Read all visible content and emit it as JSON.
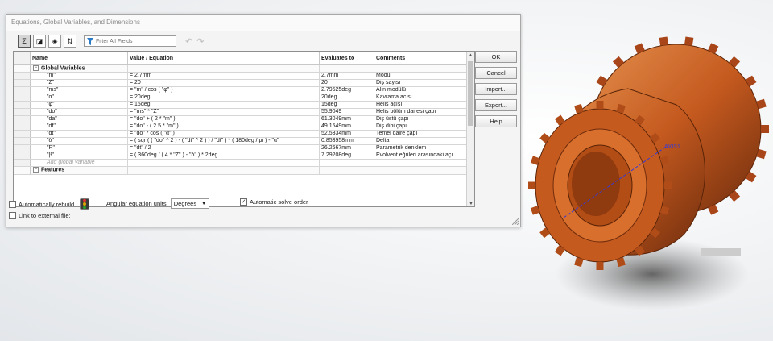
{
  "dialog": {
    "title": "Equations, Global Variables, and Dimensions",
    "filter_placeholder": "Filter All Fields"
  },
  "toolbar": {
    "icons": [
      "equation-view-icon",
      "sketch-view-icon",
      "dimension-view-icon",
      "ordered-view-icon",
      "filter-icon",
      "undo-icon",
      "redo-icon"
    ]
  },
  "table": {
    "headers": {
      "name": "Name",
      "equation": "Value / Equation",
      "evaluates": "Evaluates to",
      "comments": "Comments"
    },
    "section_global": "Global Variables",
    "rows": [
      {
        "name": "\"m\"",
        "equation": "= 2.7mm",
        "evaluates": "2.7mm",
        "comment": "Modül"
      },
      {
        "name": "\"Z\"",
        "equation": "= 20",
        "evaluates": "20",
        "comment": "Diş sayısı"
      },
      {
        "name": "\"ms\"",
        "equation": "= \"m\" / cos ( \"φ\" )",
        "evaluates": "2.79525deg",
        "comment": "Alın modülü"
      },
      {
        "name": "\"α\"",
        "equation": "= 20deg",
        "evaluates": "20deg",
        "comment": "Kavrama acısı"
      },
      {
        "name": "\"φ\"",
        "equation": "= 15deg",
        "evaluates": "15deg",
        "comment": "Helis açısı"
      },
      {
        "name": "\"do\"",
        "equation": "= \"ms\" * \"Z\"",
        "evaluates": "55.9049",
        "comment": "Helis bölüm dairesi çapı"
      },
      {
        "name": "\"da\"",
        "equation": "= \"do\" + ( 2 * \"m\" )",
        "evaluates": "61.3049mm",
        "comment": "Diş üstü çapı"
      },
      {
        "name": "\"df\"",
        "equation": "= \"do\" - ( 2.5 * \"m\" )",
        "evaluates": "49.1549mm",
        "comment": "Diş dibi çapı"
      },
      {
        "name": "\"dt\"",
        "equation": "= \"do\" * cos ( \"α\" )",
        "evaluates": "52.5334mm",
        "comment": "Temel daire çapı"
      },
      {
        "name": "\"δ\"",
        "equation": "= ( sqr ( ( \"do\" ^ 2 ) - ( \"dt\" ^ 2 ) ) / \"dt\" ) * ( 180deg / pi ) - \"α\"",
        "evaluates": "0.853958mm",
        "comment": "Delta"
      },
      {
        "name": "\"R\"",
        "equation": "= \"dt\" / 2",
        "evaluates": "26.2667mm",
        "comment": "Parametrik denklem"
      },
      {
        "name": "\"β\"",
        "equation": "= ( 360deg / ( 4 * \"Z\" ) - \"δ\" ) * 2deg",
        "evaluates": "7.29208deg",
        "comment": "Evolvent eğrileri arasındaki açı"
      }
    ],
    "add_placeholder": "Add global variable",
    "section_features": "Features"
  },
  "buttons": {
    "ok": "OK",
    "cancel": "Cancel",
    "import": "Import...",
    "export": "Export...",
    "help": "Help"
  },
  "footer": {
    "auto_rebuild": "Automatically rebuild",
    "angular_units_label": "Angular equation units:",
    "angular_units_value": "Degrees",
    "auto_solve": "Automatic solve order",
    "link_external": "Link to external file:"
  },
  "viewport": {
    "annotation": "AXIS1"
  },
  "colors": {
    "gear": "#c55a1f",
    "gear_dark": "#7a3210",
    "gear_light": "#e08a4a"
  }
}
